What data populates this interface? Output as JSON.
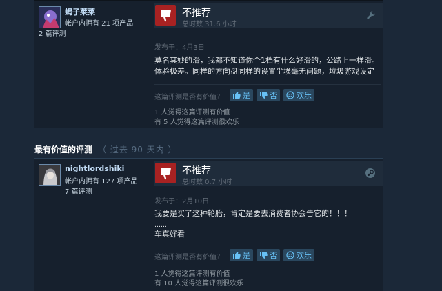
{
  "reviews": [
    {
      "author": {
        "name": "蝎子莱莱",
        "products": "帐户内拥有 21 项产品",
        "reviews": "2 篇评测"
      },
      "verdict": "不推荐",
      "hours": "总时数 31.6 小时",
      "posted": "发布于：4月3日",
      "content": [
        "莫名其妙的滑，我都不知道你个1档有什么好滑的，公路上一样滑。",
        "体验极差。同样的方向盘同样的设置尘埃毫无问题，垃圾游戏设定"
      ],
      "helpful_question": "这篇评测是否有价值？",
      "vote_yes": "是",
      "vote_no": "否",
      "vote_funny": "欢乐",
      "helpful_stat": "1 人觉得这篇评测有价值",
      "funny_stat": "有 5 人觉得这篇评测很欢乐",
      "corner_icon": "wrench-icon"
    },
    {
      "author": {
        "name": "nightlordshiki",
        "products": "帐户内拥有 127 项产品",
        "reviews": "7 篇评测"
      },
      "verdict": "不推荐",
      "hours": "总时数 0.7 小时",
      "posted": "发布于：2月10日",
      "content": [
        "我要是买了这种轮胎，肯定是要去消费者协会告它的！！！",
        "……",
        "车真好看"
      ],
      "helpful_question": "这篇评测是否有价值？",
      "vote_yes": "是",
      "vote_no": "否",
      "vote_funny": "欢乐",
      "helpful_stat": "1 人觉得这篇评测有价值",
      "funny_stat": "有 10 人觉得这篇评测很欢乐",
      "corner_icon": "steam-icon"
    }
  ],
  "section": {
    "title": "最有价值的评测",
    "subtitle": "（ 过去 90 天内 ）"
  },
  "colors": {
    "background": "#1b2838",
    "panel": "#16202d",
    "thumb_down": "#a82222",
    "link": "#67c1f5"
  }
}
